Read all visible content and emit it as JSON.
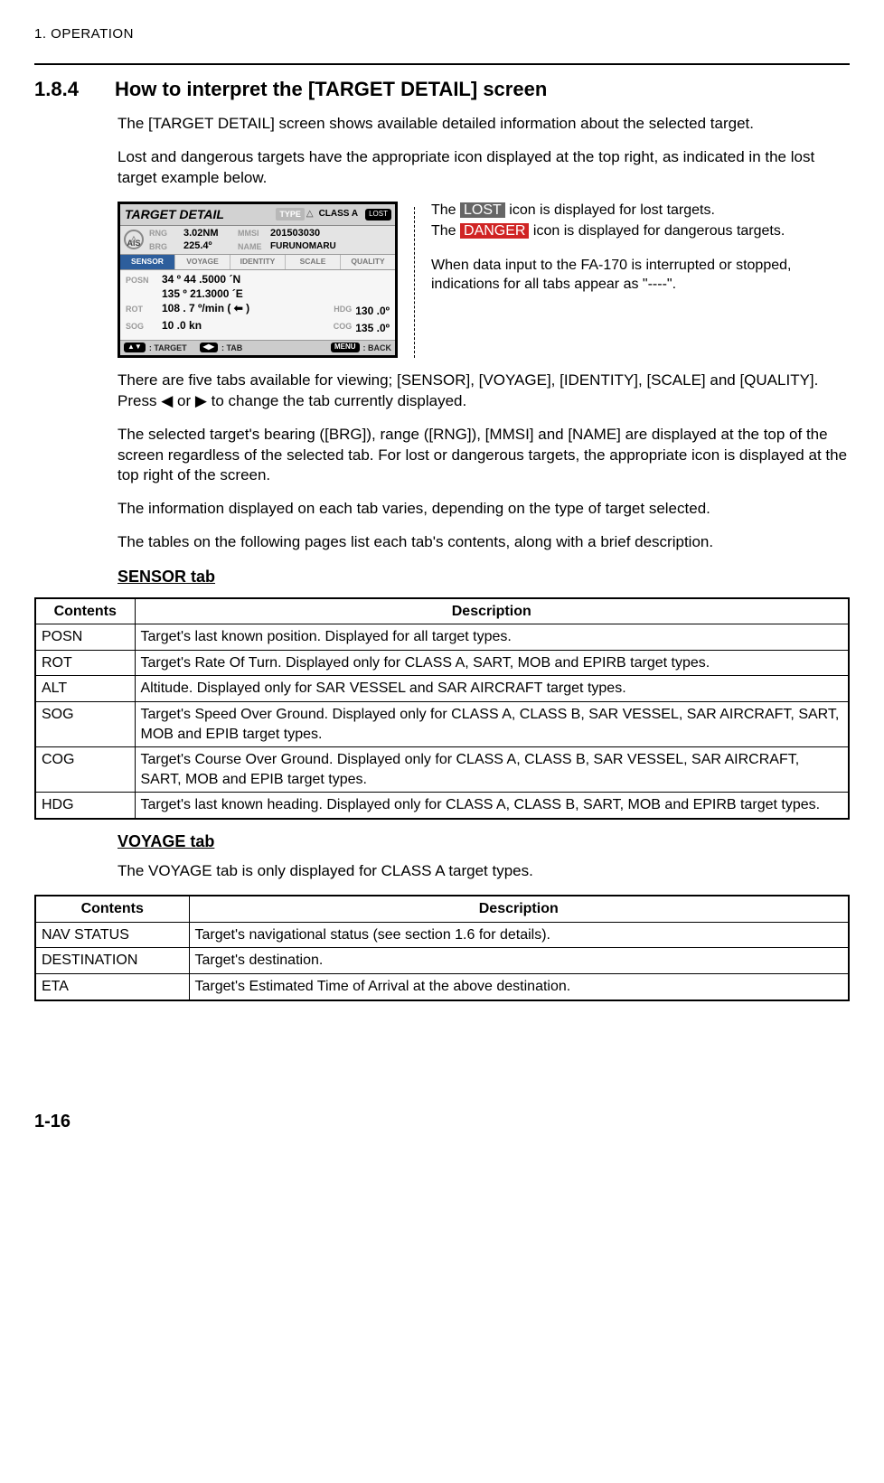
{
  "running_head": "1.  OPERATION",
  "section": {
    "num": "1.8.4",
    "title": "How to interpret the [TARGET DETAIL] screen"
  },
  "paras": {
    "p1": "The [TARGET DETAIL] screen shows available detailed information about the selected target.",
    "p2": "Lost and dangerous targets have the appropriate icon displayed at the top right, as indicated in the lost target example below.",
    "p3a": "There are five tabs available for viewing; [SENSOR], [VOYAGE], [IDENTITY], [SCALE] and [QUALITY]. Press ",
    "p3b": " or ",
    "p3c": " to change the tab currently displayed.",
    "p4": "The selected target's bearing ([BRG]), range ([RNG]), [MMSI] and [NAME] are displayed at the top of the screen regardless of the selected tab. For lost or dangerous targets, the appropriate icon is displayed at the top right of the screen.",
    "p5": "The information displayed on each tab varies, depending on the type of target selected.",
    "p6": "The tables on the following pages list each tab's contents, along with a brief description."
  },
  "triangles": {
    "left": "◀",
    "right": "▶"
  },
  "figure": {
    "title": "TARGET DETAIL",
    "type_label": "TYPE",
    "class_label": "CLASS A",
    "lost_label": "LOST",
    "ais_label": "AIS",
    "info": {
      "rng_k": "RNG",
      "rng_v": "3.02NM",
      "brg_k": "BRG",
      "brg_v": "225.4º",
      "mmsi_k": "MMSI",
      "mmsi_v": "201503030",
      "name_k": "NAME",
      "name_v": "FURUNOMARU"
    },
    "tabs": [
      "SENSOR",
      "VOYAGE",
      "IDENTITY",
      "SCALE",
      "QUALITY"
    ],
    "body": {
      "posn_k": "POSN",
      "posn_v1": "34 º 44 .5000 ´N",
      "posn_v2": "135 º 21.3000 ´E",
      "rot_k": "ROT",
      "rot_v": "108 . 7 º/min ( ⬅ )",
      "sog_k": "SOG",
      "sog_v": "10 .0 kn",
      "hdg_k": "HDG",
      "hdg_v": "130 .0º",
      "cog_k": "COG",
      "cog_v": "135 .0º"
    },
    "footer": {
      "target": ": TARGET",
      "tab": ": TAB",
      "back": ": BACK",
      "menu_key": "MENU"
    }
  },
  "callouts": {
    "c1a": "The ",
    "c1_lost": "LOST",
    "c1b": " icon is displayed for lost targets.",
    "c2a": "The ",
    "c2_danger": "DANGER",
    "c2b": " icon is displayed for dangerous targets.",
    "c3": "When data input to the FA-170 is interrupted or stopped, indications for all tabs appear as \"----\"."
  },
  "subheads": {
    "sensor": "SENSOR tab",
    "voyage": "VOYAGE tab"
  },
  "voyage_intro": "The VOYAGE tab is only displayed for CLASS A target types.",
  "sensor_table": {
    "headers": [
      "Contents",
      "Description"
    ],
    "rows": [
      [
        "POSN",
        "Target's last known position. Displayed for all target types."
      ],
      [
        "ROT",
        "Target's Rate Of Turn. Displayed only for CLASS A, SART, MOB and EPIRB target types."
      ],
      [
        "ALT",
        "Altitude. Displayed only for SAR VESSEL and SAR AIRCRAFT target types."
      ],
      [
        "SOG",
        "Target's Speed Over Ground. Displayed only for CLASS A, CLASS B, SAR VESSEL, SAR AIRCRAFT, SART, MOB and EPIB target types."
      ],
      [
        "COG",
        "Target's Course Over Ground. Displayed only for CLASS A, CLASS B, SAR VESSEL, SAR AIRCRAFT, SART, MOB and EPIB target types."
      ],
      [
        "HDG",
        "Target's last known heading. Displayed only for CLASS A, CLASS B, SART, MOB and EPIRB target types."
      ]
    ]
  },
  "voyage_table": {
    "headers": [
      "Contents",
      "Description"
    ],
    "rows": [
      [
        "NAV STATUS",
        "Target's navigational status (see section 1.6 for details)."
      ],
      [
        "DESTINATION",
        "Target's destination."
      ],
      [
        "ETA",
        "Target's Estimated Time of Arrival at the above destination."
      ]
    ]
  },
  "page_number": "1-16"
}
